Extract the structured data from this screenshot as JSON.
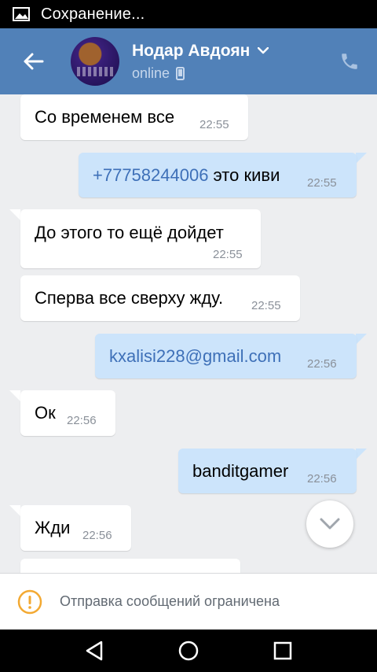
{
  "status_bar": {
    "text": "Сохранение..."
  },
  "header": {
    "name": "Нодар Авдоян",
    "status": "online"
  },
  "messages": [
    {
      "dir": "in",
      "text": "Со временем все",
      "time": "22:55"
    },
    {
      "dir": "out",
      "link": "+77758244006",
      "text": " это киви",
      "time": "22:55"
    },
    {
      "dir": "in",
      "text": "До этого то ещё дойдет",
      "time": "22:55"
    },
    {
      "dir": "in",
      "text": "Сперва все сверху жду.",
      "time": "22:55"
    },
    {
      "dir": "out",
      "link": "kxalisi228@gmail.com",
      "time": "22:56"
    },
    {
      "dir": "in",
      "text": "Ок",
      "time": "22:56"
    },
    {
      "dir": "out",
      "text": "banditgamer",
      "time": "22:56"
    },
    {
      "dir": "in",
      "text": "Жди",
      "time": "22:56"
    }
  ],
  "notice": {
    "text": "Отправка сообщений ограничена"
  },
  "colors": {
    "header_bg": "#5181b8",
    "outgoing_bubble": "#cce4fb",
    "incoming_bubble": "#ffffff",
    "link": "#3e70b8",
    "warning": "#f3a932"
  },
  "icons": {
    "status": "image-icon",
    "back": "arrow-back-icon",
    "chevron": "chevron-down-icon",
    "device": "mobile-phone-icon",
    "call": "phone-call-icon",
    "scroll": "chevron-down-icon",
    "warning": "warning-circle-icon",
    "nav_back": "triangle-back-icon",
    "nav_home": "circle-home-icon",
    "nav_recent": "square-recent-icon"
  }
}
